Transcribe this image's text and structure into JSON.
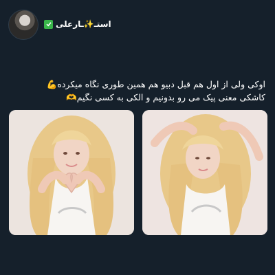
{
  "post": {
    "username": "استـ✨ـارعلی",
    "verified": true,
    "text_line1": "اوکی ولی از اول هم قبل دبیو هم همین طوری نگاه میکرده💪",
    "text_line2": "کاشکی معنی پیک می رو بدونیم و الکی به کسی نگیم🫶"
  },
  "colors": {
    "background": "#15202b",
    "badge": "#39b54a"
  },
  "icons": {
    "verified": "verified-check-icon"
  }
}
